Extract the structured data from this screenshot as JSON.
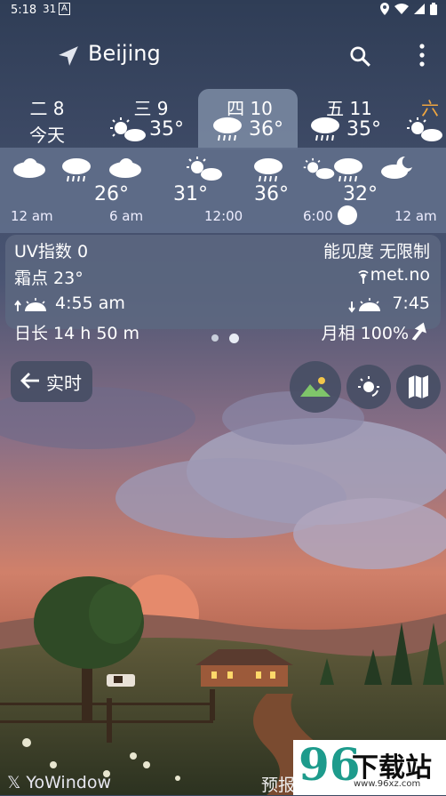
{
  "status": {
    "time": "5:18",
    "temp_icon": "31",
    "notif_icon": "A"
  },
  "header": {
    "city": "Beijing"
  },
  "days": [
    {
      "label": "二 8",
      "sub": "今天"
    },
    {
      "label": "三 9",
      "temp": "35°"
    },
    {
      "label": "四 10",
      "temp": "36°",
      "selected": true
    },
    {
      "label": "五 11",
      "temp": "35°"
    },
    {
      "label": "六"
    }
  ],
  "hourly": {
    "temps": [
      "26°",
      "31°",
      "36°",
      "32°"
    ],
    "times": [
      "12 am",
      "6 am",
      "12:00",
      "6:00",
      "12 am"
    ]
  },
  "details": {
    "uv": "UV指数 0",
    "visibility": "能见度 无限制",
    "dewpoint": "霜点 23°",
    "source": "met.no",
    "sunrise": "4:55 am",
    "sunset": "7:45",
    "daylength": "日长 14 h 50 m",
    "moon": "月相 100%"
  },
  "realtime_label": "实时",
  "brand": "YoWindow",
  "forecast_label": "预报",
  "watermark": {
    "big": "96",
    "cn": "下载站",
    "url": "www.96xz.com"
  },
  "colors": {
    "accent": "#f0a640",
    "sky_top": "#3b4a63",
    "dusk": "#d97a5e"
  }
}
